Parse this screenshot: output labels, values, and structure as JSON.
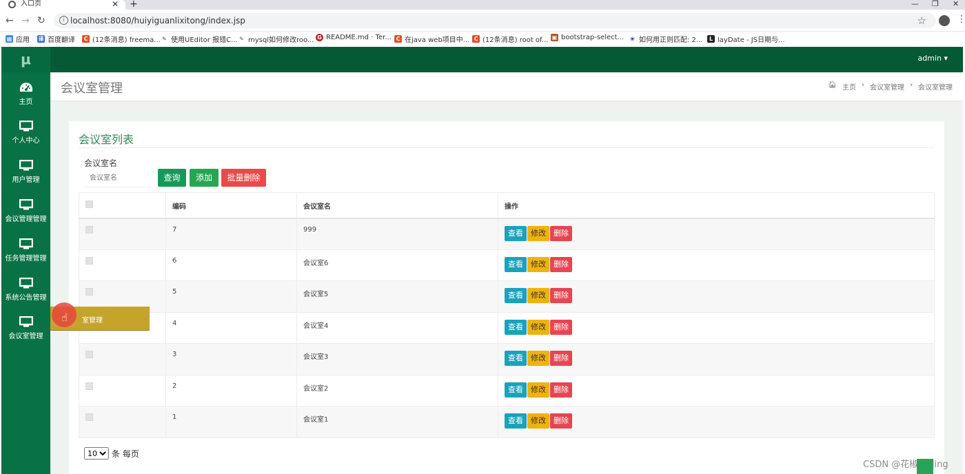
{
  "browser": {
    "tab_title": "入口页",
    "url": "localhost:8080/huiyiguanlixitong/index.jsp",
    "bookmarks": [
      {
        "label": "应用",
        "icon": "apps-grid-icon",
        "color": "#4285f4"
      },
      {
        "label": "百度翻译",
        "icon": "translate-icon",
        "color": "#2b6de8"
      },
      {
        "label": "(12条消息) freema...",
        "icon": "csdn-icon",
        "color": "#e54d26"
      },
      {
        "label": "使用UEditor 报错C...",
        "icon": "link-icon",
        "color": "#555555"
      },
      {
        "label": "mysql如何修改roo...",
        "icon": "link-icon",
        "color": "#555555"
      },
      {
        "label": "README.md · Ter...",
        "icon": "gitee-icon",
        "color": "#c71d23"
      },
      {
        "label": "在java web项目中...",
        "icon": "csdn-icon",
        "color": "#e54d26"
      },
      {
        "label": "(12条消息) root of...",
        "icon": "csdn-icon",
        "color": "#e54d26"
      },
      {
        "label": "bootstrap-select...",
        "icon": "box-icon",
        "color": "#b35a2b"
      },
      {
        "label": "如何用正则匹配: 2...",
        "icon": "baidu-icon",
        "color": "#2932e1"
      },
      {
        "label": "layDate - JS日期与...",
        "icon": "layui-icon",
        "color": "#222222"
      }
    ]
  },
  "app": {
    "logo": "μ",
    "user": "admin ▾",
    "sidebar": [
      {
        "label": "主页",
        "icon": "dashboard-icon"
      },
      {
        "label": "个人中心",
        "icon": "monitor-icon"
      },
      {
        "label": "用户管理",
        "icon": "monitor-icon"
      },
      {
        "label": "会议管理管理",
        "icon": "monitor-icon"
      },
      {
        "label": "任务管理管理",
        "icon": "monitor-icon"
      },
      {
        "label": "系统公告管理",
        "icon": "monitor-icon"
      },
      {
        "label": "会议室管理",
        "icon": "monitor-icon"
      }
    ],
    "tooltip": "室管理",
    "page_title": "会议室管理",
    "breadcrumb": [
      "主页",
      "会议室管理",
      "会议室管理"
    ],
    "card_title": "会议室列表",
    "search": {
      "label": "会议室名",
      "placeholder": "会议室名"
    },
    "buttons": {
      "query": "查询",
      "add": "添加",
      "batch_delete": "批量删除"
    },
    "table": {
      "headers": [
        "编码",
        "会议室名",
        "操作"
      ],
      "rows": [
        {
          "id": "7",
          "name": "999"
        },
        {
          "id": "6",
          "name": "会议室6"
        },
        {
          "id": "5",
          "name": "会议室5"
        },
        {
          "id": "4",
          "name": "会议室4"
        },
        {
          "id": "3",
          "name": "会议室3"
        },
        {
          "id": "2",
          "name": "会议室2"
        },
        {
          "id": "1",
          "name": "会议室1"
        }
      ],
      "actions": {
        "view": "查看",
        "edit": "修改",
        "delete": "删除"
      }
    },
    "pager": {
      "page_size": "10",
      "suffix": "条 每页"
    },
    "watermark": "CSDN @花椒coding"
  },
  "colors": {
    "sidebar": "#087244",
    "header": "#055a35",
    "title_green": "#2e8b57"
  }
}
